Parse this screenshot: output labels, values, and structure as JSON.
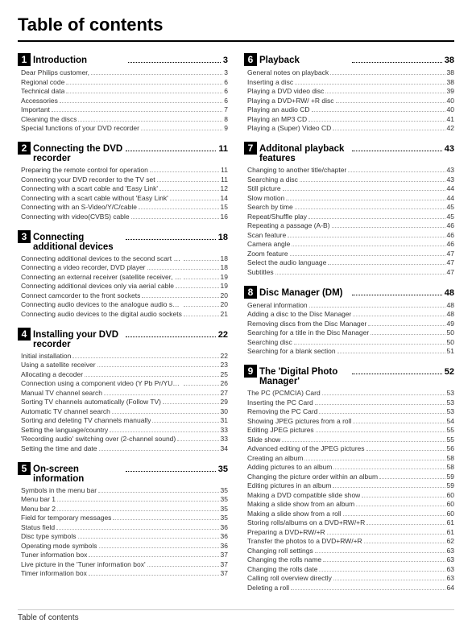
{
  "title": "Table of contents",
  "footer": "Table of contents",
  "sections": [
    {
      "num": "1",
      "title": "Introduction",
      "page": "3",
      "entries": [
        {
          "text": "Dear Philips customer,",
          "page": "3"
        },
        {
          "text": "Regional code",
          "page": "6"
        },
        {
          "text": "Technical data",
          "page": "6"
        },
        {
          "text": "Accessories",
          "page": "6"
        },
        {
          "text": "Important",
          "page": "7"
        },
        {
          "text": "Cleaning the discs",
          "page": "8"
        },
        {
          "text": "Special functions of your DVD recorder",
          "page": "9"
        }
      ]
    },
    {
      "num": "2",
      "title": "Connecting the DVD recorder ...",
      "page": "11",
      "entries": [
        {
          "text": "Preparing the remote control for operation",
          "page": "11"
        },
        {
          "text": "Connecting your DVD recorder to the TV set",
          "page": "11"
        },
        {
          "text": "Connecting with a scart cable and 'Easy Link'",
          "page": "12"
        },
        {
          "text": "Connecting with a scart cable without 'Easy Link'",
          "page": "14"
        },
        {
          "text": "Connecting with an S-Video/Y/C/cable",
          "page": "15"
        },
        {
          "text": "Connecting with video(CVBS) cable",
          "page": "16"
        }
      ]
    },
    {
      "num": "3",
      "title": "Connecting additional devices ....",
      "page": "18",
      "entries": [
        {
          "text": "Connecting additional devices to the second scart socket",
          "page": "18"
        },
        {
          "text": "Connecting a video recorder, DVD player",
          "page": "18"
        },
        {
          "text": "Connecting an external receiver (satellite receiver, set-top box, cable TV box...)",
          "page": "19"
        },
        {
          "text": "Connecting additional devices only via aerial cable",
          "page": "19"
        },
        {
          "text": "Connect camcorder to the front sockets",
          "page": "20"
        },
        {
          "text": "Connecting audio devices to the analogue audio sockets",
          "page": "20"
        },
        {
          "text": "Connecting audio devices to the digital audio sockets",
          "page": "21"
        }
      ]
    },
    {
      "num": "4",
      "title": "Installing your DVD recorder .....",
      "page": "22",
      "entries": [
        {
          "text": "Initial installation",
          "page": "22"
        },
        {
          "text": "Using a satellite receiver",
          "page": "23"
        },
        {
          "text": "Allocating a decoder",
          "page": "25"
        },
        {
          "text": "Connection using a component video (Y Pb Pr/YUV) cable",
          "page": "26"
        },
        {
          "text": "Manual TV channel search",
          "page": "27"
        },
        {
          "text": "Sorting TV channels automatically (Follow TV)",
          "page": "29"
        },
        {
          "text": "Automatic TV channel search",
          "page": "30"
        },
        {
          "text": "Sorting and deleting TV channels manually",
          "page": "31"
        },
        {
          "text": "Setting the language/country",
          "page": "33"
        },
        {
          "text": "'Recording audio' switching over (2-channel sound)",
          "page": "33"
        },
        {
          "text": "Setting the time and date",
          "page": "34"
        }
      ]
    },
    {
      "num": "5",
      "title": "On-screen information",
      "page": "35",
      "entries": [
        {
          "text": "Symbols in the menu bar",
          "page": "35"
        },
        {
          "text": "Menu bar 1",
          "page": "35"
        },
        {
          "text": "Menu bar 2",
          "page": "35"
        },
        {
          "text": "Field for temporary messages",
          "page": "35"
        },
        {
          "text": "Status field",
          "page": "36"
        },
        {
          "text": "Disc type symbols",
          "page": "36"
        },
        {
          "text": "Operating mode symbols",
          "page": "36"
        },
        {
          "text": "Tuner information box",
          "page": "37"
        },
        {
          "text": "Live picture in the 'Tuner information box'",
          "page": "37"
        },
        {
          "text": "Timer information box",
          "page": "37"
        }
      ]
    },
    {
      "num": "6",
      "title": "Playback",
      "page": "38",
      "entries": [
        {
          "text": "General notes on playback",
          "page": "38"
        },
        {
          "text": "Inserting a disc",
          "page": "38"
        },
        {
          "text": "Playing a DVD video disc",
          "page": "39"
        },
        {
          "text": "Playing a DVD+RW/ +R disc",
          "page": "40"
        },
        {
          "text": "Playing an audio CD",
          "page": "40"
        },
        {
          "text": "Playing an MP3 CD",
          "page": "41"
        },
        {
          "text": "Playing a (Super) Video CD",
          "page": "42"
        }
      ]
    },
    {
      "num": "7",
      "title": "Additonal playback features .......",
      "page": "43",
      "entries": [
        {
          "text": "Changing to another title/chapter",
          "page": "43"
        },
        {
          "text": "Searching a disc",
          "page": "43"
        },
        {
          "text": "Still picture",
          "page": "44"
        },
        {
          "text": "Slow motion",
          "page": "44"
        },
        {
          "text": "Search by time",
          "page": "45"
        },
        {
          "text": "Repeat/Shuffle play",
          "page": "45"
        },
        {
          "text": "Repeating a passage (A-B)",
          "page": "46"
        },
        {
          "text": "Scan feature",
          "page": "46"
        },
        {
          "text": "Camera angle",
          "page": "46"
        },
        {
          "text": "Zoom feature",
          "page": "47"
        },
        {
          "text": "Select the audio language",
          "page": "47"
        },
        {
          "text": "Subtitles",
          "page": "47"
        }
      ]
    },
    {
      "num": "8",
      "title": "Disc Manager (DM)",
      "page": "48",
      "entries": [
        {
          "text": "General information",
          "page": "48"
        },
        {
          "text": "Adding a disc to the Disc Manager",
          "page": "48"
        },
        {
          "text": "Removing discs from the Disc Manager",
          "page": "49"
        },
        {
          "text": "Searching for a title in the Disc Manager",
          "page": "50"
        },
        {
          "text": "Searching disc",
          "page": "50"
        },
        {
          "text": "Searching for a blank section",
          "page": "51"
        }
      ]
    },
    {
      "num": "9",
      "title": "The 'Digital Photo Manager' .......",
      "page": "52",
      "entries": [
        {
          "text": "The PC (PCMCIA) Card",
          "page": "53"
        },
        {
          "text": "Inserting the PC Card",
          "page": "53"
        },
        {
          "text": "Removing the PC Card",
          "page": "53"
        },
        {
          "text": "Showing JPEG pictures from a roll",
          "page": "54"
        },
        {
          "text": "Editing JPEG pictures",
          "page": "55"
        },
        {
          "text": "Slide show",
          "page": "55"
        },
        {
          "text": "Advanced editing of the JPEG pictures",
          "page": "56"
        },
        {
          "text": "Creating an album",
          "page": "58"
        },
        {
          "text": "Adding pictures to an album",
          "page": "58"
        },
        {
          "text": "Changing the picture order within an album",
          "page": "59"
        },
        {
          "text": "Editing pictures in an album",
          "page": "59"
        },
        {
          "text": "Making a DVD compatible slide show",
          "page": "60"
        },
        {
          "text": "Making a slide show from an album",
          "page": "60"
        },
        {
          "text": "Making a slide show from a roll",
          "page": "60"
        },
        {
          "text": "Storing rolls/albums on a DVD+RW/+R",
          "page": "61"
        },
        {
          "text": "Preparing a DVD+RW/+R",
          "page": "61"
        },
        {
          "text": "Transfer the photos to a DVD+RW/+R",
          "page": "62"
        },
        {
          "text": "Changing roll settings",
          "page": "63"
        },
        {
          "text": "Changing the rolls name",
          "page": "63"
        },
        {
          "text": "Changing the rolls date",
          "page": "63"
        },
        {
          "text": "Calling roll overview directly",
          "page": "63"
        },
        {
          "text": "Deleting a roll",
          "page": "64"
        }
      ]
    }
  ]
}
